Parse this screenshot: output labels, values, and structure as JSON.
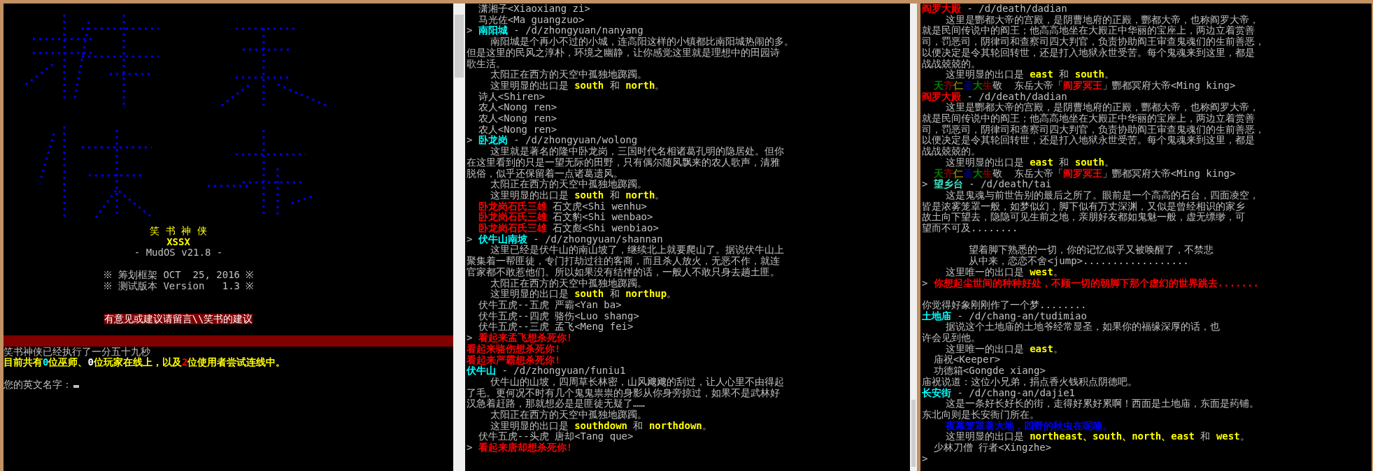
{
  "panes": [
    {
      "kind": "login",
      "banner": {
        "title": "笑 书 神 侠",
        "subtitle": "XSSX",
        "version": "- MudOS v21.8 -",
        "info": [
          "※ 筹划框架 OCT  25, 2016 ※",
          "※ 测试版本 Version   1.3 ※"
        ],
        "notice": "有意见或建议请留言\\\\笑书的建议"
      },
      "lines": [
        {
          "kind": "text",
          "segments": [
            {
              "text": "笑书神侠已经执行了一分五十九秒"
            }
          ]
        },
        {
          "kind": "text",
          "segments": [
            {
              "text": "目前共有",
              "color": "#ffff00"
            },
            {
              "text": "0",
              "color": "#00ffff"
            },
            {
              "text": "位巫师、",
              "color": "#ffff00"
            },
            {
              "text": "0",
              "color": "#ffffff"
            },
            {
              "text": "位玩家在线上，以及",
              "color": "#ffff00"
            },
            {
              "text": "2",
              "color": "#ff0000"
            },
            {
              "text": "位使用者尝试连线中。",
              "color": "#ffff00"
            }
          ]
        },
        {
          "kind": "blank"
        },
        {
          "kind": "prompt",
          "segments": [
            {
              "text": "您的英文名字："
            }
          ]
        }
      ]
    },
    {
      "kind": "log",
      "lines": [
        {
          "kind": "text",
          "segments": [
            {
              "text": "  潇湘子<Xiaoxiang zi>"
            }
          ]
        },
        {
          "kind": "text",
          "segments": [
            {
              "text": "  马光佐<Ma guangzuo>"
            }
          ]
        },
        {
          "kind": "text",
          "segments": [
            {
              "text": "> "
            },
            {
              "text": "南阳城",
              "color": "#00ffff"
            },
            {
              "text": " - /d/zhongyuan/nanyang"
            }
          ]
        },
        {
          "kind": "text",
          "segments": [
            {
              "text": "    南阳城是个再小不过的小城，连高阳这样的小镇都比南阳城热闹的多。"
            }
          ]
        },
        {
          "kind": "text",
          "segments": [
            {
              "text": "但是这里的民风之淳朴，环境之幽静，让你感觉这里就是理想中的田园诗"
            }
          ]
        },
        {
          "kind": "text",
          "segments": [
            {
              "text": "歌生活。"
            }
          ]
        },
        {
          "kind": "text",
          "segments": [
            {
              "text": "    太阳正在西方的天空中孤独地踯躅。"
            }
          ]
        },
        {
          "kind": "text",
          "segments": [
            {
              "text": "    这里明显的出口是 "
            },
            {
              "text": "south",
              "color": "#ffff00"
            },
            {
              "text": " 和 "
            },
            {
              "text": "north",
              "color": "#ffff00"
            },
            {
              "text": "。"
            }
          ]
        },
        {
          "kind": "text",
          "segments": [
            {
              "text": "  诗人<Shiren>"
            }
          ]
        },
        {
          "kind": "text",
          "segments": [
            {
              "text": "  农人<Nong ren>"
            }
          ]
        },
        {
          "kind": "text",
          "segments": [
            {
              "text": "  农人<Nong ren>"
            }
          ]
        },
        {
          "kind": "text",
          "segments": [
            {
              "text": "  农人<Nong ren>"
            }
          ]
        },
        {
          "kind": "text",
          "segments": [
            {
              "text": "> "
            },
            {
              "text": "卧龙岗",
              "color": "#00ffff"
            },
            {
              "text": " - /d/zhongyuan/wolong"
            }
          ]
        },
        {
          "kind": "text",
          "segments": [
            {
              "text": "    这里就是著名的隆中卧龙岗，三国时代名相诸葛孔明的隐居处。但你"
            }
          ]
        },
        {
          "kind": "text",
          "segments": [
            {
              "text": "在这里看到的只是一望无际的田野，只有偶尔随风飘来的农人歌声，清雅"
            }
          ]
        },
        {
          "kind": "text",
          "segments": [
            {
              "text": "脱俗，似乎还保留着一点诸葛遗风。"
            }
          ]
        },
        {
          "kind": "text",
          "segments": [
            {
              "text": "    太阳正在西方的天空中孤独地踯躅。"
            }
          ]
        },
        {
          "kind": "text",
          "segments": [
            {
              "text": "    这里明显的出口是 "
            },
            {
              "text": "south",
              "color": "#ffff00"
            },
            {
              "text": " 和 "
            },
            {
              "text": "north",
              "color": "#ffff00"
            },
            {
              "text": "。"
            }
          ]
        },
        {
          "kind": "text",
          "segments": [
            {
              "text": "  卧龙岗石氏三雄",
              "color": "#ff0000"
            },
            {
              "text": " 石文虎<Shi wenhu>"
            }
          ]
        },
        {
          "kind": "text",
          "segments": [
            {
              "text": "  卧龙岗石氏三雄",
              "color": "#ff0000"
            },
            {
              "text": " 石文豹<Shi wenbao>"
            }
          ]
        },
        {
          "kind": "text",
          "segments": [
            {
              "text": "  卧龙岗石氏三雄",
              "color": "#ff0000"
            },
            {
              "text": " 石文彪<Shi wenbiao>"
            }
          ]
        },
        {
          "kind": "text",
          "segments": [
            {
              "text": "> "
            },
            {
              "text": "伏牛山南坡",
              "color": "#00ffff"
            },
            {
              "text": " - /d/zhongyuan/shannan"
            }
          ]
        },
        {
          "kind": "text",
          "segments": [
            {
              "text": "    这里已经是伏牛山的南山坡了，继续北上就要爬山了。据说伏牛山上"
            }
          ]
        },
        {
          "kind": "text",
          "segments": [
            {
              "text": "聚集着一帮匪徒，专门打劫过往的客商，而且杀人放火，无恶不作，就连"
            }
          ]
        },
        {
          "kind": "text",
          "segments": [
            {
              "text": "官家都不敢惹他们。所以如果没有结伴的话，一般人不敢只身去趟土匪。"
            }
          ]
        },
        {
          "kind": "text",
          "segments": [
            {
              "text": "    太阳正在西方的天空中孤独地踯躅。"
            }
          ]
        },
        {
          "kind": "text",
          "segments": [
            {
              "text": "    这里明显的出口是 "
            },
            {
              "text": "south",
              "color": "#ffff00"
            },
            {
              "text": " 和 "
            },
            {
              "text": "northup",
              "color": "#ffff00"
            },
            {
              "text": "。"
            }
          ]
        },
        {
          "kind": "text",
          "segments": [
            {
              "text": "  伏牛五虎--五虎 严霸<Yan ba>"
            }
          ]
        },
        {
          "kind": "text",
          "segments": [
            {
              "text": "  伏牛五虎--四虎 骆伤<Luo shang>"
            }
          ]
        },
        {
          "kind": "text",
          "segments": [
            {
              "text": "  伏牛五虎--三虎 孟飞<Meng fei>"
            }
          ]
        },
        {
          "kind": "text",
          "segments": [
            {
              "text": "> "
            },
            {
              "text": "看起来孟飞想杀死你!",
              "color": "#ff0000"
            }
          ]
        },
        {
          "kind": "text",
          "segments": [
            {
              "text": "看起来骆伤想杀死你!",
              "color": "#ff0000"
            }
          ]
        },
        {
          "kind": "text",
          "segments": [
            {
              "text": "看起来严霸想杀死你!",
              "color": "#ff0000"
            }
          ]
        },
        {
          "kind": "text",
          "segments": [
            {
              "text": "伏牛山",
              "color": "#00ffff"
            },
            {
              "text": " - /d/zhongyuan/funiu1"
            }
          ]
        },
        {
          "kind": "text",
          "segments": [
            {
              "text": "    伏牛山的山坡，四周草长林密，山风飕飕的刮过，让人心里不由得起"
            }
          ]
        },
        {
          "kind": "text",
          "segments": [
            {
              "text": "了毛。更何况不时有几个鬼鬼祟祟的身影从你身旁掠过，如果不是武林好"
            }
          ]
        },
        {
          "kind": "text",
          "segments": [
            {
              "text": "汉急着赶路，那就想必是是匪徒无疑了……"
            }
          ]
        },
        {
          "kind": "text",
          "segments": [
            {
              "text": "    太阳正在西方的天空中孤独地踯躅。"
            }
          ]
        },
        {
          "kind": "text",
          "segments": [
            {
              "text": "    这里明显的出口是 "
            },
            {
              "text": "southdown",
              "color": "#ffff00"
            },
            {
              "text": " 和 "
            },
            {
              "text": "northdown",
              "color": "#ffff00"
            },
            {
              "text": "。"
            }
          ]
        },
        {
          "kind": "text",
          "segments": [
            {
              "text": "  伏牛五虎--头虎 唐却<Tang que>"
            }
          ]
        },
        {
          "kind": "text",
          "segments": [
            {
              "text": "> "
            },
            {
              "text": "看起来唐却想杀死你!",
              "color": "#ff0000"
            }
          ]
        }
      ]
    },
    {
      "kind": "log",
      "lines": [
        {
          "kind": "text",
          "segments": [
            {
              "text": "阎罗大殿",
              "color": "#ff0000"
            },
            {
              "text": " - /d/death/dadian"
            }
          ]
        },
        {
          "kind": "text",
          "segments": [
            {
              "text": "    这里是酆都大帝的宫殿，是阴曹地府的正殿，酆都大帝，也称阎罗大帝，"
            }
          ]
        },
        {
          "kind": "text",
          "segments": [
            {
              "text": "就是民间传说中的阎王；他高高地坐在大殿正中华丽的宝座上，两边立着赏善"
            }
          ]
        },
        {
          "kind": "text",
          "segments": [
            {
              "text": "司，罚恶司，阴律司和查察司四大判官，负责协助阎王审查鬼魂们的生前善恶，"
            }
          ]
        },
        {
          "kind": "text",
          "segments": [
            {
              "text": "以便决定是令其轮回转世，还是打入地狱永世受苦。每个鬼魂来到这里，都是"
            }
          ]
        },
        {
          "kind": "text",
          "segments": [
            {
              "text": "战战兢兢的。"
            }
          ]
        },
        {
          "kind": "text",
          "segments": [
            {
              "text": "    这里明显的出口是 "
            },
            {
              "text": "east",
              "color": "#ffff00"
            },
            {
              "text": " 和 "
            },
            {
              "text": "south",
              "color": "#ffff00"
            },
            {
              "text": "。"
            }
          ]
        },
        {
          "kind": "text",
          "segments": [
            {
              "text": "  天",
              "color": "#008000"
            },
            {
              "text": "齐",
              "color": "#800000"
            },
            {
              "text": "仁",
              "color": "#808000"
            },
            {
              "text": "圣",
              "color": "#000080"
            },
            {
              "text": "大",
              "color": "#008000"
            },
            {
              "text": "生",
              "color": "#800000"
            },
            {
              "text": "敬  东岳大帝「"
            },
            {
              "text": "阎罗冥王",
              "color": "#ff0000"
            },
            {
              "text": "」酆都冥府大帝<Ming king>"
            }
          ]
        },
        {
          "kind": "text",
          "segments": [
            {
              "text": "阎罗大殿",
              "color": "#ff0000"
            },
            {
              "text": " - /d/death/dadian"
            }
          ]
        },
        {
          "kind": "text",
          "segments": [
            {
              "text": "    这里是酆都大帝的宫殿，是阴曹地府的正殿，酆都大帝，也称阎罗大帝，"
            }
          ]
        },
        {
          "kind": "text",
          "segments": [
            {
              "text": "就是民间传说中的阎王；他高高地坐在大殿正中华丽的宝座上，两边立着赏善"
            }
          ]
        },
        {
          "kind": "text",
          "segments": [
            {
              "text": "司，罚恶司，阴律司和查察司四大判官，负责协助阎王审查鬼魂们的生前善恶，"
            }
          ]
        },
        {
          "kind": "text",
          "segments": [
            {
              "text": "以便决定是令其轮回转世，还是打入地狱永世受苦。每个鬼魂来到这里，都是"
            }
          ]
        },
        {
          "kind": "text",
          "segments": [
            {
              "text": "战战兢兢的。"
            }
          ]
        },
        {
          "kind": "text",
          "segments": [
            {
              "text": "    这里明显的出口是 "
            },
            {
              "text": "east",
              "color": "#ffff00"
            },
            {
              "text": " 和 "
            },
            {
              "text": "south",
              "color": "#ffff00"
            },
            {
              "text": "。"
            }
          ]
        },
        {
          "kind": "text",
          "segments": [
            {
              "text": "  天",
              "color": "#008000"
            },
            {
              "text": "齐",
              "color": "#800000"
            },
            {
              "text": "仁",
              "color": "#808000"
            },
            {
              "text": "圣",
              "color": "#000080"
            },
            {
              "text": "大",
              "color": "#008000"
            },
            {
              "text": "生",
              "color": "#800000"
            },
            {
              "text": "敬  东岳大帝「"
            },
            {
              "text": "阎罗冥王",
              "color": "#ff0000"
            },
            {
              "text": "」酆都冥府大帝<Ming king>"
            }
          ]
        },
        {
          "kind": "text",
          "segments": [
            {
              "text": "> "
            },
            {
              "text": "望乡台",
              "color": "#40e0c0"
            },
            {
              "text": " - /d/death/tai"
            }
          ]
        },
        {
          "kind": "text",
          "segments": [
            {
              "text": "    这是鬼魂与前世告别的最后之所了。眼前是一个高高的石台，四面凌空，"
            }
          ]
        },
        {
          "kind": "text",
          "segments": [
            {
              "text": "皆是浓雾笼罩一般，如梦似幻，脚下似有万丈深渊，又似是曾经相识的家乡"
            }
          ]
        },
        {
          "kind": "text",
          "segments": [
            {
              "text": "故土向下望去，隐隐可见生前之地，亲朋好友都如鬼魅一般，虚无缥缈，可"
            }
          ]
        },
        {
          "kind": "text",
          "segments": [
            {
              "text": "望而不可及........"
            }
          ]
        },
        {
          "kind": "blank"
        },
        {
          "kind": "text",
          "segments": [
            {
              "text": "        望着脚下熟悉的一切，你的记忆似乎又被唤醒了，不禁悲"
            }
          ]
        },
        {
          "kind": "text",
          "segments": [
            {
              "text": "        从中来，恋恋不舍<jump>.................."
            }
          ]
        },
        {
          "kind": "text",
          "segments": [
            {
              "text": "    这里唯一的出口是 "
            },
            {
              "text": "west",
              "color": "#ffff00"
            },
            {
              "text": "。"
            }
          ]
        },
        {
          "kind": "text",
          "segments": [
            {
              "text": "> "
            },
            {
              "text": "你想起尘世间的种种好处，不顾一切的朝脚下那个虚幻的世界跳去.......",
              "color": "#ff0000"
            }
          ]
        },
        {
          "kind": "blank"
        },
        {
          "kind": "text",
          "segments": [
            {
              "text": "你觉得好象刚刚作了一个梦........"
            }
          ]
        },
        {
          "kind": "text",
          "segments": [
            {
              "text": "土地庙",
              "color": "#00ffff"
            },
            {
              "text": " - /d/chang-an/tudimiao"
            }
          ]
        },
        {
          "kind": "text",
          "segments": [
            {
              "text": "    据说这个土地庙的土地爷经常显圣，如果你的福缘深厚的话，也"
            }
          ]
        },
        {
          "kind": "text",
          "segments": [
            {
              "text": "许会见到他。"
            }
          ]
        },
        {
          "kind": "text",
          "segments": [
            {
              "text": "    这里唯一的出口是 "
            },
            {
              "text": "east",
              "color": "#ffff00"
            },
            {
              "text": "。"
            }
          ]
        },
        {
          "kind": "text",
          "segments": [
            {
              "text": "  庙祝<Keeper>"
            }
          ]
        },
        {
          "kind": "text",
          "segments": [
            {
              "text": "  功德箱<Gongde xiang>"
            }
          ]
        },
        {
          "kind": "text",
          "segments": [
            {
              "text": "庙祝说道：这位小兄弟，捐点香火钱积点阴德吧。"
            }
          ]
        },
        {
          "kind": "text",
          "segments": [
            {
              "text": "长安街",
              "color": "#00ffff"
            },
            {
              "text": " - /d/chang-an/dajie1"
            }
          ]
        },
        {
          "kind": "text",
          "segments": [
            {
              "text": "    这是一条好长好长的街，走得好累好累啊！西面是土地庙，东面是药铺。"
            }
          ]
        },
        {
          "kind": "text",
          "segments": [
            {
              "text": "东北向则是长安衙门所在。"
            }
          ]
        },
        {
          "kind": "text",
          "segments": [
            {
              "text": "    夜幕笼罩著大地，四野的秋虫在呢喃。",
              "color": "#0000ff"
            }
          ]
        },
        {
          "kind": "text",
          "segments": [
            {
              "text": "    这里明显的出口是 "
            },
            {
              "text": "northeast、south、north、east",
              "color": "#ffff00"
            },
            {
              "text": " 和 "
            },
            {
              "text": "west",
              "color": "#ffff00"
            },
            {
              "text": "。"
            }
          ]
        },
        {
          "kind": "text",
          "segments": [
            {
              "text": "  少林刀僧 行者<Xingzhe>"
            }
          ]
        },
        {
          "kind": "text",
          "segments": [
            {
              "text": ">"
            }
          ]
        }
      ]
    }
  ]
}
